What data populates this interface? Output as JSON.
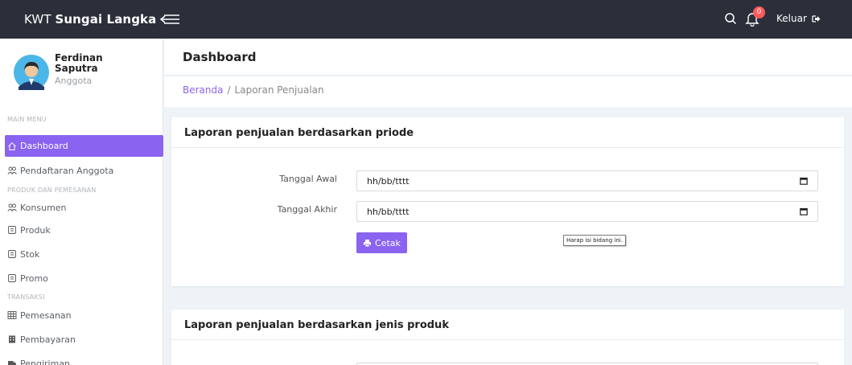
{
  "topbar": {
    "brand_prefix": "KWT ",
    "brand_name": "Sungai Langka",
    "notification_count": "0",
    "logout_label": "Keluar"
  },
  "user": {
    "name": "Ferdinan Saputra",
    "role": "Anggota"
  },
  "sidebar": {
    "sections": [
      "MAIN MENU",
      "PRODUK DAN PEMESANAN",
      "TRANSAKSI"
    ],
    "items": [
      {
        "label": "Dashboard",
        "icon": "home-icon"
      },
      {
        "label": "Pendaftaran Anggota",
        "icon": "users-icon"
      },
      {
        "label": "Konsumen",
        "icon": "users-icon"
      },
      {
        "label": "Produk",
        "icon": "document-icon"
      },
      {
        "label": "Stok",
        "icon": "document-icon"
      },
      {
        "label": "Promo",
        "icon": "document-icon"
      },
      {
        "label": "Pemesanan",
        "icon": "table-icon"
      },
      {
        "label": "Pembayaran",
        "icon": "building-icon"
      },
      {
        "label": "Pengiriman",
        "icon": "truck-icon"
      }
    ]
  },
  "page": {
    "title": "Dashboard",
    "breadcrumb": {
      "home": "Beranda",
      "separator": "/",
      "current": "Laporan Penjualan"
    }
  },
  "report_period": {
    "title": "Laporan penjualan berdasarkan priode",
    "start_label": "Tanggal Awal",
    "start_value": "hh/bb/tttt",
    "end_label": "Tanggal Akhir",
    "end_value": "hh/bb/tttt",
    "print_label": "Cetak",
    "tooltip": "Harap isi bidang ini."
  },
  "report_product": {
    "title": "Laporan penjualan berdasarkan jenis produk"
  },
  "colors": {
    "topbar": "#2b2f3a",
    "accent": "#8a63f0",
    "badge": "#ff5b5b",
    "background": "#eef3f7"
  }
}
